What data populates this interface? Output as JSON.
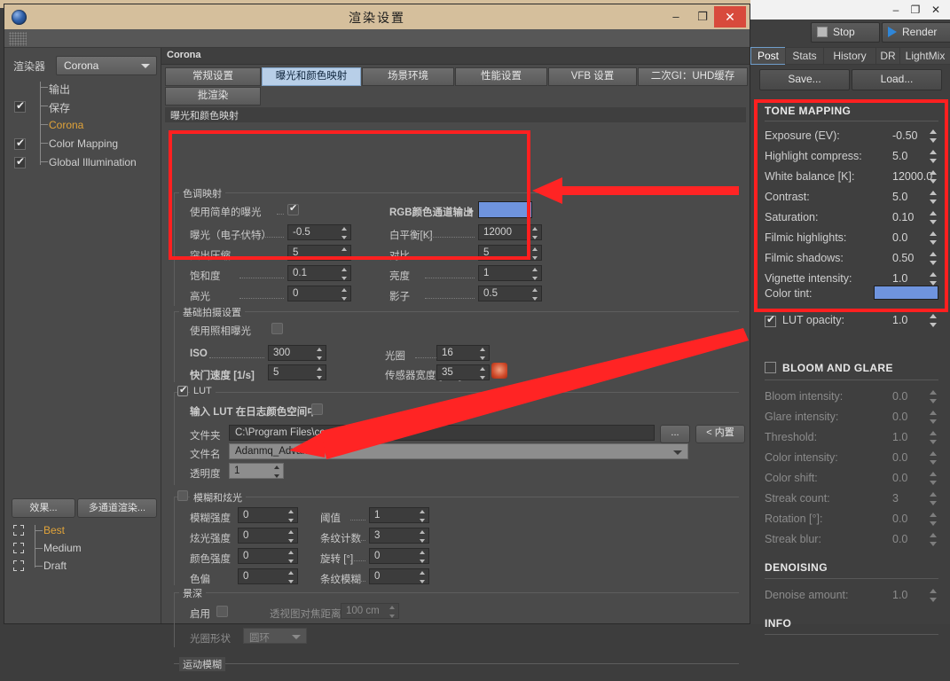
{
  "window": {
    "title": "渲染设置",
    "minimize": "–",
    "maximize": "❐",
    "close": "✕"
  },
  "outer_window": {
    "minimize": "–",
    "maximize": "❐",
    "close": "✕"
  },
  "sidebar": {
    "renderer_label": "渲染器",
    "renderer_value": "Corona",
    "tree": [
      {
        "label": "输出",
        "checked": false,
        "accent": false
      },
      {
        "label": "保存",
        "checked": true,
        "accent": false
      },
      {
        "label": "Corona",
        "checked": false,
        "accent": true
      },
      {
        "label": "Color Mapping",
        "checked": true,
        "accent": false
      },
      {
        "label": "Global Illumination",
        "checked": true,
        "accent": false
      }
    ],
    "effects_button": "效果...",
    "multipass_button": "多通道渲染...",
    "presets": [
      {
        "label": "Best",
        "accent": true
      },
      {
        "label": "Medium",
        "accent": false
      },
      {
        "label": "Draft",
        "accent": false
      }
    ]
  },
  "content": {
    "header": "Corona",
    "tabs_row1": [
      "常规设置",
      "曝光和颜色映射",
      "场景环境",
      "性能设置",
      "VFB 设置",
      "二次GI：UHD缓存"
    ],
    "tabs_row2": [
      "批渲染"
    ],
    "active_tab": "曝光和颜色映射",
    "section_title": "曝光和颜色映射",
    "tone_group": {
      "title": "色调映射",
      "simple_exposure_label": "使用简单的曝光",
      "simple_exposure_checked": true,
      "rgb_output_label": "RGB颜色通道输出",
      "rgb_output_color": "#6f94de",
      "rows_left": [
        {
          "label": "曝光（电子伏特）",
          "value": "-0.5"
        },
        {
          "label": "突出压缩",
          "value": "5"
        },
        {
          "label": "饱和度",
          "value": "0.1"
        },
        {
          "label": "高光",
          "value": "0"
        }
      ],
      "rows_right": [
        {
          "label": "白平衡[K]",
          "value": "12000"
        },
        {
          "label": "对比",
          "value": "5"
        },
        {
          "label": "亮度",
          "value": "1"
        },
        {
          "label": "影子",
          "value": "0.5"
        }
      ]
    },
    "camera_group": {
      "title": "基础拍摄设置",
      "use_photo_exposure_label": "使用照相曝光",
      "use_photo_exposure_checked": false,
      "rows": [
        {
          "label": "ISO",
          "value": "300"
        },
        {
          "label": "光圈",
          "value": "16"
        },
        {
          "label": "快门速度 [1/s]",
          "value": "5"
        },
        {
          "label": "传感器宽度 [mm]",
          "value": "35"
        }
      ]
    },
    "lut_group": {
      "title": "LUT",
      "enabled": true,
      "log_space_label": "输入 LUT 在日志颜色空间中",
      "log_space_checked": false,
      "folder_label": "文件夹",
      "folder_value": "C:\\Program Files\\corona\\lut",
      "browse_button": "...",
      "builtin_button": "< 内置",
      "filename_label": "文件名",
      "filename_value": "Adanmq_Advantix_400",
      "opacity_label": "透明度",
      "opacity_value": "1"
    },
    "bloom_group": {
      "title": "模糊和炫光",
      "enabled": false,
      "rows_left": [
        {
          "label": "模糊强度",
          "value": "0"
        },
        {
          "label": "炫光强度",
          "value": "0"
        },
        {
          "label": "颜色强度",
          "value": "0"
        },
        {
          "label": "色偏",
          "value": "0"
        }
      ],
      "rows_right": [
        {
          "label": "阈值",
          "value": "1"
        },
        {
          "label": "条纹计数",
          "value": "3"
        },
        {
          "label": "旋转 [°]",
          "value": "0"
        },
        {
          "label": "条纹模糊",
          "value": "0"
        }
      ]
    },
    "dof_group": {
      "title": "景深",
      "enable_label": "启用",
      "enable_checked": false,
      "focus_distance_label": "透视图对焦距离",
      "focus_distance_value": "100 cm",
      "aperture_shape_label": "光圈形状",
      "aperture_shape_value": "圆环"
    },
    "motion_blur_group": {
      "title": "运动模糊"
    }
  },
  "vfb": {
    "stop_button": "Stop",
    "render_button": "Render",
    "tabs": [
      "Post",
      "Stats",
      "History",
      "DR",
      "LightMix"
    ],
    "active_tab": "Post",
    "save_button": "Save...",
    "load_button": "Load...",
    "tone_mapping": {
      "heading": "TONE MAPPING",
      "rows": [
        {
          "label": "Exposure (EV):",
          "value": "-0.50"
        },
        {
          "label": "Highlight compress:",
          "value": "5.0"
        },
        {
          "label": "White balance [K]:",
          "value": "12000.0"
        },
        {
          "label": "Contrast:",
          "value": "5.0"
        },
        {
          "label": "Saturation:",
          "value": "0.10"
        },
        {
          "label": "Filmic highlights:",
          "value": "0.0"
        },
        {
          "label": "Filmic shadows:",
          "value": "0.50"
        },
        {
          "label": "Vignette intensity:",
          "value": "1.0"
        }
      ],
      "color_tint_label": "Color tint:",
      "color_tint_color": "#6f94de",
      "lut_opacity_label": "LUT opacity:",
      "lut_opacity_value": "1.0",
      "lut_opacity_checked": true
    },
    "bloom_and_glare": {
      "heading": "BLOOM AND GLARE",
      "enabled": false,
      "rows": [
        {
          "label": "Bloom intensity:",
          "value": "0.0"
        },
        {
          "label": "Glare intensity:",
          "value": "0.0"
        },
        {
          "label": "Threshold:",
          "value": "1.0"
        },
        {
          "label": "Color intensity:",
          "value": "0.0"
        },
        {
          "label": "Color shift:",
          "value": "0.0"
        },
        {
          "label": "Streak count:",
          "value": "3"
        },
        {
          "label": "Rotation [°]:",
          "value": "0.0"
        },
        {
          "label": "Streak blur:",
          "value": "0.0"
        }
      ]
    },
    "denoising": {
      "heading": "DENOISING",
      "rows": [
        {
          "label": "Denoise amount:",
          "value": "1.0"
        }
      ]
    },
    "info": {
      "heading": "INFO"
    }
  },
  "annotations": {
    "highlight_color": "#ff2020",
    "arrow_color": "#ff2424"
  }
}
